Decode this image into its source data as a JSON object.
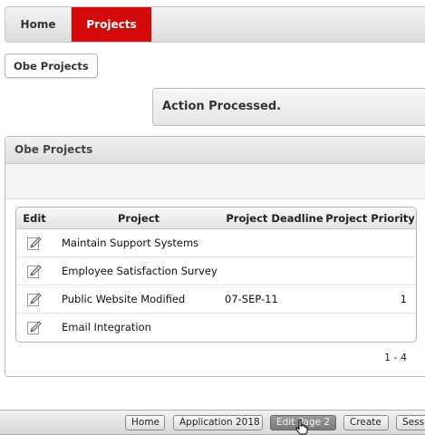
{
  "tabs": {
    "home": "Home",
    "projects": "Projects"
  },
  "breadcrumb": {
    "current": "Obe Projects"
  },
  "notification": {
    "message": "Action Processed."
  },
  "region": {
    "title": "Obe Projects"
  },
  "report": {
    "columns": {
      "edit": "Edit",
      "project": "Project",
      "deadline": "Project Deadline",
      "priority": "Project Priority"
    },
    "rows": [
      {
        "project": "Maintain Support Systems",
        "deadline": "",
        "priority": ""
      },
      {
        "project": "Employee Satisfaction Survey",
        "deadline": "",
        "priority": ""
      },
      {
        "project": "Public Website Modified",
        "deadline": "07-SEP-11",
        "priority": "1"
      },
      {
        "project": "Email Integration",
        "deadline": "",
        "priority": ""
      }
    ],
    "pagination": "1 - 4"
  },
  "developer_toolbar": {
    "home": "Home",
    "application": "Application 2018",
    "edit_page": "Edit Page 2",
    "create": "Create",
    "session": "Session"
  },
  "colors": {
    "active_tab": "#d40a0a"
  },
  "icons": {
    "edit": "pencil-icon"
  }
}
